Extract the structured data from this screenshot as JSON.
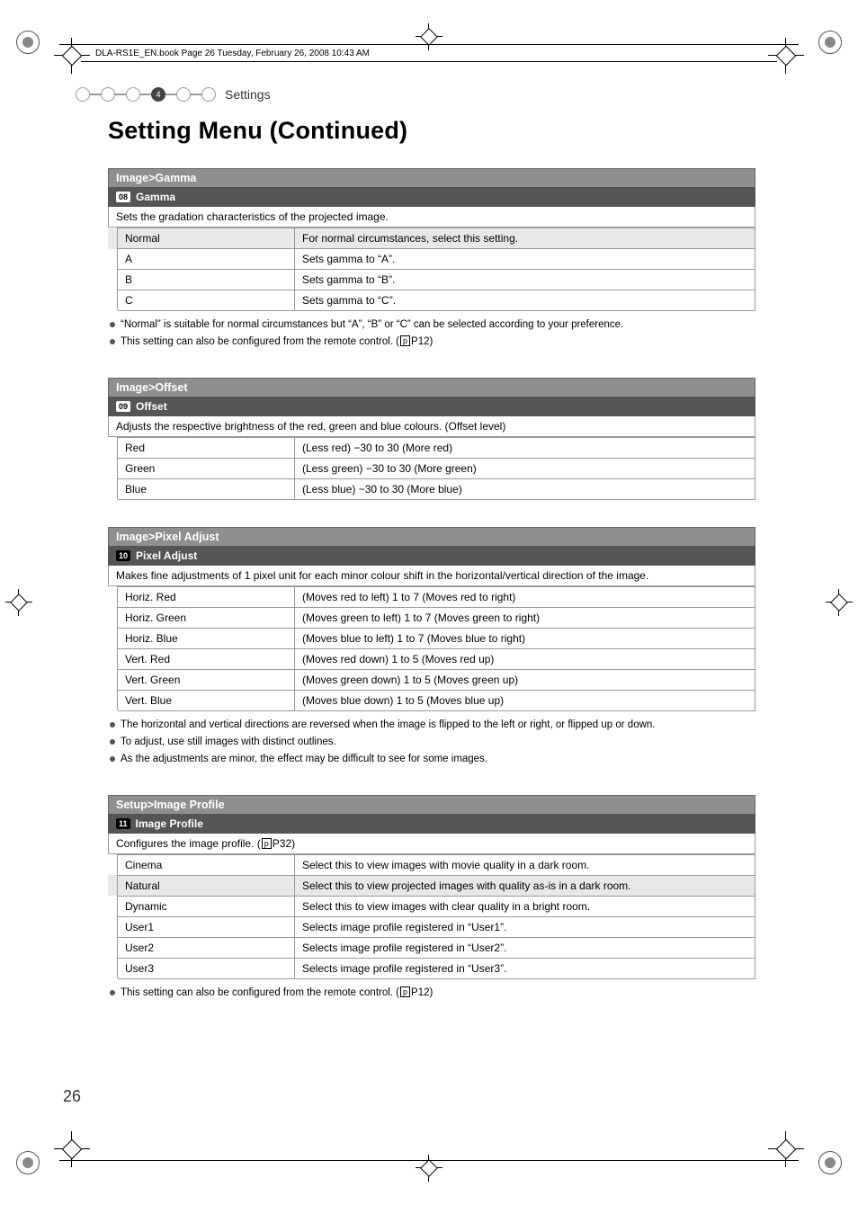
{
  "header_line": "DLA-RS1E_EN.book  Page 26  Tuesday, February 26, 2008  10:43 AM",
  "breadcrumb_step": "4",
  "breadcrumb_label": "Settings",
  "title": "Setting Menu (Continued)",
  "page_number": "26",
  "gamma": {
    "breadcrumb": "Image>Gamma",
    "num": "08",
    "label": "Gamma",
    "desc": "Sets the gradation characteristics of the projected image.",
    "rows": [
      {
        "name": "Normal",
        "value": "For normal circumstances, select this setting.",
        "hl": true
      },
      {
        "name": "A",
        "value": "Sets gamma to “A”."
      },
      {
        "name": "B",
        "value": "Sets gamma to “B”."
      },
      {
        "name": "C",
        "value": "Sets gamma to “C”."
      }
    ],
    "notes": [
      "“Normal” is suitable for normal circumstances but “A”, “B” or “C” can be selected according to your preference.",
      "This setting can also be configured from the remote control. (↖P12)"
    ],
    "ref": "P12"
  },
  "offset": {
    "breadcrumb": "Image>Offset",
    "num": "09",
    "label": "Offset",
    "desc": "Adjusts the respective brightness of the red, green and blue colours. (Offset level)",
    "rows": [
      {
        "name": "Red",
        "value": "(Less red) −30 to 30 (More red)"
      },
      {
        "name": "Green",
        "value": "(Less green) −30 to 30 (More green)"
      },
      {
        "name": "Blue",
        "value": "(Less blue) −30 to 30 (More blue)"
      }
    ]
  },
  "pixel": {
    "breadcrumb": "Image>Pixel Adjust",
    "num": "10",
    "label": "Pixel Adjust",
    "desc": "Makes fine adjustments of 1 pixel unit for each minor colour shift in the horizontal/vertical direction of the image.",
    "rows": [
      {
        "name": "Horiz. Red",
        "value": "(Moves red to left) 1 to 7 (Moves red to right)"
      },
      {
        "name": "Horiz. Green",
        "value": "(Moves green to left) 1 to 7 (Moves green to right)"
      },
      {
        "name": "Horiz. Blue",
        "value": "(Moves blue to left) 1 to 7 (Moves blue to right)"
      },
      {
        "name": "Vert. Red",
        "value": "(Moves red down) 1 to 5 (Moves red up)"
      },
      {
        "name": "Vert. Green",
        "value": "(Moves green down) 1 to 5 (Moves green up)"
      },
      {
        "name": "Vert. Blue",
        "value": "(Moves blue down) 1 to 5 (Moves blue up)"
      }
    ],
    "notes": [
      "The horizontal and vertical directions are reversed when the image is flipped to the left or right, or flipped up or down.",
      "To adjust, use still images with distinct outlines.",
      "As the adjustments are minor, the effect may be difficult to see for some images."
    ]
  },
  "profile": {
    "breadcrumb": "Setup>Image Profile",
    "num": "11",
    "label": "Image Profile",
    "desc_prefix": "Configures the image profile. (",
    "desc_ref": "P32",
    "desc_suffix": ")",
    "rows": [
      {
        "name": "Cinema",
        "value": "Select this to view images with movie quality in a dark room."
      },
      {
        "name": "Natural",
        "value": "Select this to view projected images with quality as-is in a dark room.",
        "hl": true
      },
      {
        "name": "Dynamic",
        "value": "Select this to view images with clear quality in a bright room."
      },
      {
        "name": "User1",
        "value": "Selects image profile registered in “User1”."
      },
      {
        "name": "User2",
        "value": "Selects image profile registered in “User2”."
      },
      {
        "name": "User3",
        "value": "Selects image profile registered in “User3”."
      }
    ],
    "notes_prefix": "This setting can also be configured from the remote control. (",
    "notes_ref": "P12",
    "notes_suffix": ")"
  }
}
